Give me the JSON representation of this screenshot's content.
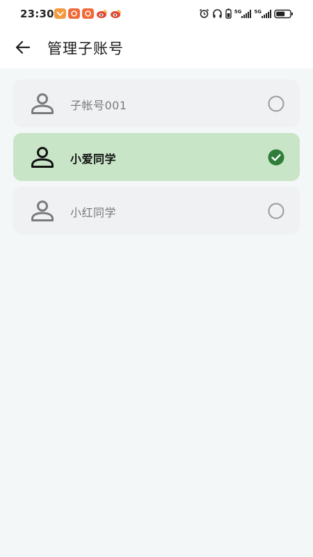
{
  "status_bar": {
    "time": "23:30",
    "notification_icons": [
      "app-icon",
      "shop-icon",
      "shop-icon",
      "weibo-icon",
      "weibo-icon"
    ],
    "system_icons": [
      "alarm-icon",
      "headphones-icon",
      "battery-saver-icon",
      "signal-5g-icon",
      "signal-5g-icon",
      "battery-icon"
    ],
    "network_label_1": "5G",
    "network_label_2": "5G"
  },
  "header": {
    "title": "管理子账号",
    "back_icon": "arrow-left-icon"
  },
  "accounts": [
    {
      "name": "子帐号001",
      "selected": false
    },
    {
      "name": "小爱同学",
      "selected": true
    },
    {
      "name": "小红同学",
      "selected": false
    }
  ],
  "colors": {
    "selected_bg": "#c8e5c7",
    "unselected_bg": "#f0f1f3",
    "check": "#2e7d3a",
    "page_bg": "#f4f7f8"
  }
}
